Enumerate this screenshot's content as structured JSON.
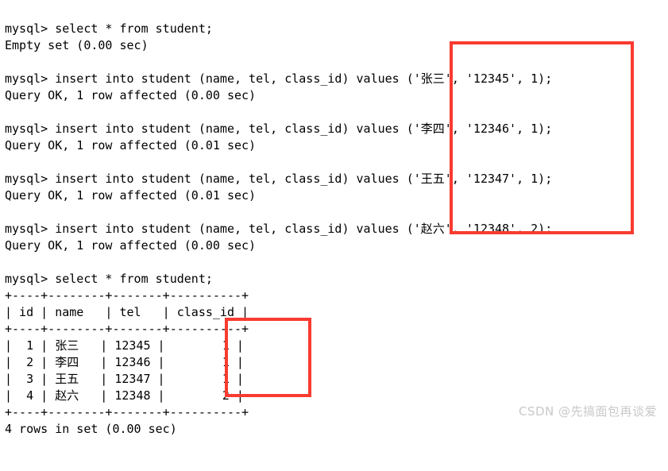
{
  "terminal": {
    "prompt": "mysql> ",
    "lines": [
      {
        "kind": "command",
        "text": "mysql> select * from student;"
      },
      {
        "kind": "result",
        "text": "Empty set (0.00 sec)"
      },
      {
        "kind": "blank",
        "text": ""
      },
      {
        "kind": "command",
        "text": "mysql> insert into student (name, tel, class_id) values ('张三', '12345', 1);"
      },
      {
        "kind": "result",
        "text": "Query OK, 1 row affected (0.00 sec)"
      },
      {
        "kind": "blank",
        "text": ""
      },
      {
        "kind": "command",
        "text": "mysql> insert into student (name, tel, class_id) values ('李四', '12346', 1);"
      },
      {
        "kind": "result",
        "text": "Query OK, 1 row affected (0.01 sec)"
      },
      {
        "kind": "blank",
        "text": ""
      },
      {
        "kind": "command",
        "text": "mysql> insert into student (name, tel, class_id) values ('王五', '12347', 1);"
      },
      {
        "kind": "result",
        "text": "Query OK, 1 row affected (0.01 sec)"
      },
      {
        "kind": "blank",
        "text": ""
      },
      {
        "kind": "command",
        "text": "mysql> insert into student (name, tel, class_id) values ('赵六', '12348', 2);"
      },
      {
        "kind": "result",
        "text": "Query OK, 1 row affected (0.00 sec)"
      },
      {
        "kind": "blank",
        "text": ""
      },
      {
        "kind": "command",
        "text": "mysql> select * from student;"
      },
      {
        "kind": "rule",
        "text": "+----+--------+-------+----------+"
      },
      {
        "kind": "header",
        "text": "| id | name   | tel   | class_id |"
      },
      {
        "kind": "rule",
        "text": "+----+--------+-------+----------+"
      },
      {
        "kind": "row",
        "text": "|  1 | 张三   | 12345 |        1 |"
      },
      {
        "kind": "row",
        "text": "|  2 | 李四   | 12346 |        1 |"
      },
      {
        "kind": "row",
        "text": "|  3 | 王五   | 12347 |        1 |"
      },
      {
        "kind": "row",
        "text": "|  4 | 赵六   | 12348 |        2 |"
      },
      {
        "kind": "rule",
        "text": "+----+--------+-------+----------+"
      },
      {
        "kind": "result",
        "text": "4 rows in set (0.00 sec)"
      }
    ],
    "statements": {
      "select_all": "select * from student;",
      "empty_set": "Empty set (0.00 sec)",
      "insert_template": "insert into student (name, tel, class_id) values",
      "query_ok": "Query OK, 1 row affected",
      "rows_in_set": "4 rows in set (0.00 sec)"
    },
    "inserts": [
      {
        "name": "张三",
        "tel": "12345",
        "class_id": "1",
        "time": "0.00 sec"
      },
      {
        "name": "李四",
        "tel": "12346",
        "class_id": "1",
        "time": "0.01 sec"
      },
      {
        "name": "王五",
        "tel": "12347",
        "class_id": "1",
        "time": "0.01 sec"
      },
      {
        "name": "赵六",
        "tel": "12348",
        "class_id": "2",
        "time": "0.00 sec"
      }
    ],
    "result_table": {
      "columns": [
        "id",
        "name",
        "tel",
        "class_id"
      ],
      "rows": [
        [
          "1",
          "张三",
          "12345",
          "1"
        ],
        [
          "2",
          "李四",
          "12346",
          "1"
        ],
        [
          "3",
          "王五",
          "12347",
          "1"
        ],
        [
          "4",
          "赵六",
          "12348",
          "2"
        ]
      ],
      "row_count_text": "4 rows in set (0.00 sec)"
    }
  },
  "annotations": {
    "color": "#f93b30",
    "boxes": [
      {
        "id": "values-box",
        "label": "highlighted inserted values"
      },
      {
        "id": "classid-box",
        "label": "highlighted class_id column"
      }
    ]
  },
  "watermark": {
    "text": "CSDN @先搞面包再谈爱",
    "color": "#c9c9c9"
  }
}
